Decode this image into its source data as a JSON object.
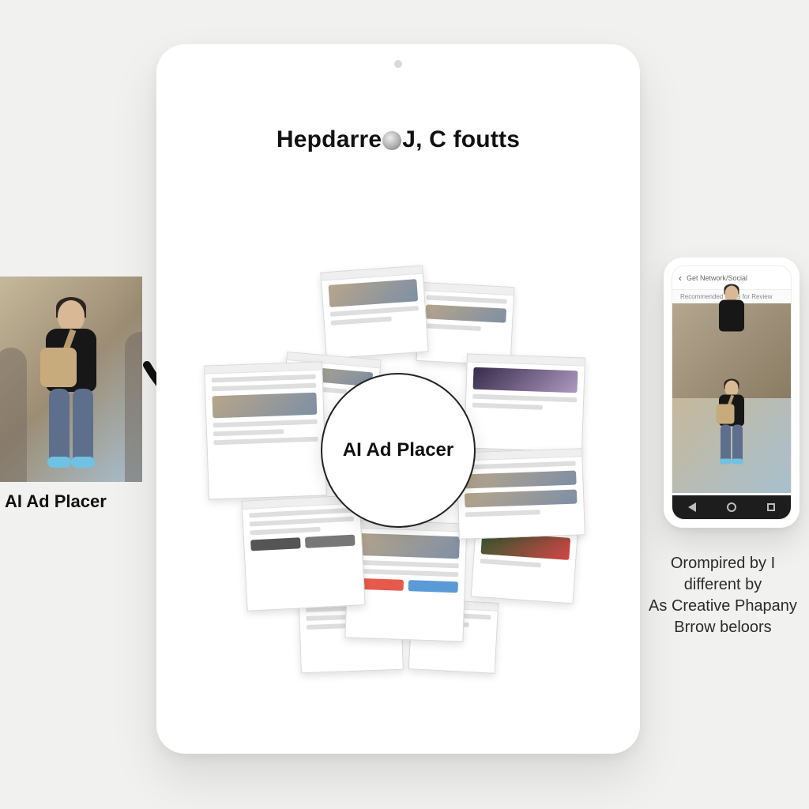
{
  "source": {
    "label": "AI Ad Placer"
  },
  "tablet": {
    "heading_left": "Hepdarre",
    "heading_right": "J, C foutts"
  },
  "center": {
    "label": "AI Ad Placer"
  },
  "phone": {
    "topbar": "Get Network/Social",
    "subtitle": "Recommended Posts for Review",
    "caption_line1": "Orompired by I",
    "caption_line2": "different by",
    "caption_line3": "As Creative Phapany",
    "caption_line4": "Brrow beloors"
  }
}
